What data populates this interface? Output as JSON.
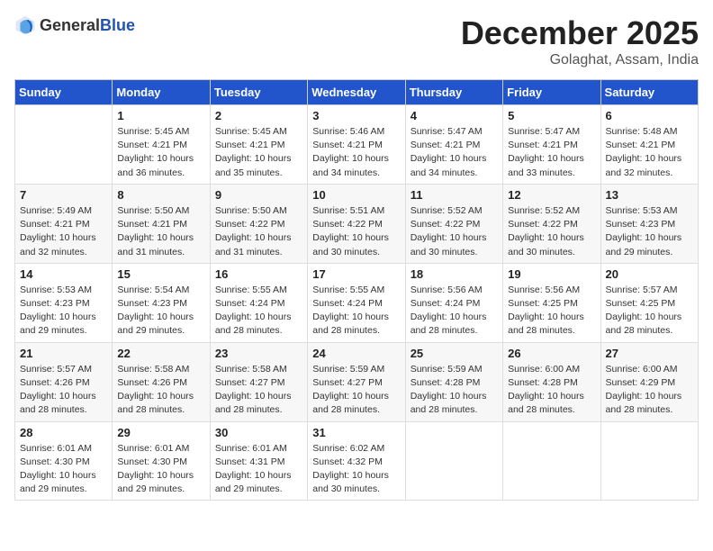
{
  "header": {
    "logo_general": "General",
    "logo_blue": "Blue",
    "month": "December 2025",
    "location": "Golaghat, Assam, India"
  },
  "days_of_week": [
    "Sunday",
    "Monday",
    "Tuesday",
    "Wednesday",
    "Thursday",
    "Friday",
    "Saturday"
  ],
  "weeks": [
    [
      {
        "day": "",
        "info": ""
      },
      {
        "day": "1",
        "info": "Sunrise: 5:45 AM\nSunset: 4:21 PM\nDaylight: 10 hours\nand 36 minutes."
      },
      {
        "day": "2",
        "info": "Sunrise: 5:45 AM\nSunset: 4:21 PM\nDaylight: 10 hours\nand 35 minutes."
      },
      {
        "day": "3",
        "info": "Sunrise: 5:46 AM\nSunset: 4:21 PM\nDaylight: 10 hours\nand 34 minutes."
      },
      {
        "day": "4",
        "info": "Sunrise: 5:47 AM\nSunset: 4:21 PM\nDaylight: 10 hours\nand 34 minutes."
      },
      {
        "day": "5",
        "info": "Sunrise: 5:47 AM\nSunset: 4:21 PM\nDaylight: 10 hours\nand 33 minutes."
      },
      {
        "day": "6",
        "info": "Sunrise: 5:48 AM\nSunset: 4:21 PM\nDaylight: 10 hours\nand 32 minutes."
      }
    ],
    [
      {
        "day": "7",
        "info": "Sunrise: 5:49 AM\nSunset: 4:21 PM\nDaylight: 10 hours\nand 32 minutes."
      },
      {
        "day": "8",
        "info": "Sunrise: 5:50 AM\nSunset: 4:21 PM\nDaylight: 10 hours\nand 31 minutes."
      },
      {
        "day": "9",
        "info": "Sunrise: 5:50 AM\nSunset: 4:22 PM\nDaylight: 10 hours\nand 31 minutes."
      },
      {
        "day": "10",
        "info": "Sunrise: 5:51 AM\nSunset: 4:22 PM\nDaylight: 10 hours\nand 30 minutes."
      },
      {
        "day": "11",
        "info": "Sunrise: 5:52 AM\nSunset: 4:22 PM\nDaylight: 10 hours\nand 30 minutes."
      },
      {
        "day": "12",
        "info": "Sunrise: 5:52 AM\nSunset: 4:22 PM\nDaylight: 10 hours\nand 30 minutes."
      },
      {
        "day": "13",
        "info": "Sunrise: 5:53 AM\nSunset: 4:23 PM\nDaylight: 10 hours\nand 29 minutes."
      }
    ],
    [
      {
        "day": "14",
        "info": "Sunrise: 5:53 AM\nSunset: 4:23 PM\nDaylight: 10 hours\nand 29 minutes."
      },
      {
        "day": "15",
        "info": "Sunrise: 5:54 AM\nSunset: 4:23 PM\nDaylight: 10 hours\nand 29 minutes."
      },
      {
        "day": "16",
        "info": "Sunrise: 5:55 AM\nSunset: 4:24 PM\nDaylight: 10 hours\nand 28 minutes."
      },
      {
        "day": "17",
        "info": "Sunrise: 5:55 AM\nSunset: 4:24 PM\nDaylight: 10 hours\nand 28 minutes."
      },
      {
        "day": "18",
        "info": "Sunrise: 5:56 AM\nSunset: 4:24 PM\nDaylight: 10 hours\nand 28 minutes."
      },
      {
        "day": "19",
        "info": "Sunrise: 5:56 AM\nSunset: 4:25 PM\nDaylight: 10 hours\nand 28 minutes."
      },
      {
        "day": "20",
        "info": "Sunrise: 5:57 AM\nSunset: 4:25 PM\nDaylight: 10 hours\nand 28 minutes."
      }
    ],
    [
      {
        "day": "21",
        "info": "Sunrise: 5:57 AM\nSunset: 4:26 PM\nDaylight: 10 hours\nand 28 minutes."
      },
      {
        "day": "22",
        "info": "Sunrise: 5:58 AM\nSunset: 4:26 PM\nDaylight: 10 hours\nand 28 minutes."
      },
      {
        "day": "23",
        "info": "Sunrise: 5:58 AM\nSunset: 4:27 PM\nDaylight: 10 hours\nand 28 minutes."
      },
      {
        "day": "24",
        "info": "Sunrise: 5:59 AM\nSunset: 4:27 PM\nDaylight: 10 hours\nand 28 minutes."
      },
      {
        "day": "25",
        "info": "Sunrise: 5:59 AM\nSunset: 4:28 PM\nDaylight: 10 hours\nand 28 minutes."
      },
      {
        "day": "26",
        "info": "Sunrise: 6:00 AM\nSunset: 4:28 PM\nDaylight: 10 hours\nand 28 minutes."
      },
      {
        "day": "27",
        "info": "Sunrise: 6:00 AM\nSunset: 4:29 PM\nDaylight: 10 hours\nand 28 minutes."
      }
    ],
    [
      {
        "day": "28",
        "info": "Sunrise: 6:01 AM\nSunset: 4:30 PM\nDaylight: 10 hours\nand 29 minutes."
      },
      {
        "day": "29",
        "info": "Sunrise: 6:01 AM\nSunset: 4:30 PM\nDaylight: 10 hours\nand 29 minutes."
      },
      {
        "day": "30",
        "info": "Sunrise: 6:01 AM\nSunset: 4:31 PM\nDaylight: 10 hours\nand 29 minutes."
      },
      {
        "day": "31",
        "info": "Sunrise: 6:02 AM\nSunset: 4:32 PM\nDaylight: 10 hours\nand 30 minutes."
      },
      {
        "day": "",
        "info": ""
      },
      {
        "day": "",
        "info": ""
      },
      {
        "day": "",
        "info": ""
      }
    ]
  ]
}
